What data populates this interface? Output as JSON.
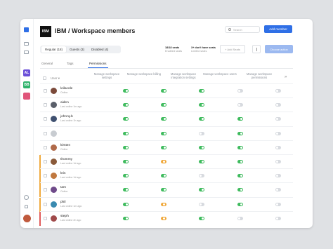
{
  "rail": {
    "avatars": [
      {
        "label": "AL",
        "color": "#6a4fd8"
      },
      {
        "label": "BB",
        "color": "#2fb36b"
      },
      {
        "label": "",
        "color": "#e0557a"
      }
    ]
  },
  "header": {
    "logo_text": "IBM",
    "title": "IBM / Workspace members",
    "search_placeholder": "Search",
    "add_member_label": "Add member"
  },
  "toolbar": {
    "segments": [
      "Regular (18)",
      "Guests (3)",
      "Disabled (4)"
    ],
    "active_segment": 0,
    "stats": [
      {
        "value": "18/18 seats",
        "label": "Enabled seats"
      },
      {
        "value": "3+ don't have seats",
        "label": "Limited seats"
      }
    ],
    "add_seats_label": "+ Add Seats",
    "choose_action_label": "Choose action"
  },
  "tabs": [
    "General",
    "Tags",
    "Permissions"
  ],
  "active_tab": 2,
  "table": {
    "user_header": "User",
    "columns": [
      "Manage workspace settings",
      "Manage workspace billing",
      "Manage workspace integration settings",
      "Manage workspace users",
      "Manage workspace permissions"
    ],
    "rows": [
      {
        "name": "leilacole",
        "sub": "Online",
        "flag": "",
        "avatar": "#7b4a3a",
        "toggles": [
          "on",
          "on",
          "on",
          "off",
          "off"
        ]
      },
      {
        "name": "aiden",
        "sub": "Last online 1m ago",
        "flag": "",
        "avatar": "#5a5f6a",
        "toggles": [
          "on",
          "on",
          "on",
          "off",
          "off"
        ]
      },
      {
        "name": "johnny.b",
        "sub": "Last online 1h ago",
        "flag": "",
        "avatar": "#3f5070",
        "toggles": [
          "on",
          "on",
          "on",
          "on",
          "off"
        ]
      },
      {
        "name": "",
        "sub": "",
        "flag": "",
        "avatar": "#c8ccd1",
        "toggles": [
          "on",
          "on",
          "off",
          "on",
          "off"
        ]
      },
      {
        "name": "kirsten",
        "sub": "Online",
        "flag": "",
        "avatar": "#b06a4a",
        "toggles": [
          "on",
          "on",
          "on",
          "on",
          "off"
        ]
      },
      {
        "name": "thommy",
        "sub": "Last online 1d ago",
        "flag": "#f0a93c",
        "avatar": "#8a5a3a",
        "toggles": [
          "on",
          "partial",
          "on",
          "on",
          "off"
        ]
      },
      {
        "name": "kris",
        "sub": "Last online 1d ago",
        "flag": "#f0a93c",
        "avatar": "#c0783f",
        "toggles": [
          "on",
          "on",
          "off",
          "on",
          "off"
        ]
      },
      {
        "name": "tam",
        "sub": "Online",
        "flag": "#f0a93c",
        "avatar": "#6f4a8a",
        "toggles": [
          "on",
          "on",
          "on",
          "on",
          "off"
        ]
      },
      {
        "name": "phil",
        "sub": "Last online 1m ago",
        "flag": "#f0a93c",
        "avatar": "#3a8ab0",
        "toggles": [
          "on",
          "partial",
          "off",
          "on",
          "off"
        ]
      },
      {
        "name": "steph",
        "sub": "Last online 2h ago",
        "flag": "#e05a5a",
        "avatar": "#a04a4a",
        "toggles": [
          "on",
          "partial",
          "on",
          "off",
          "off"
        ]
      }
    ]
  }
}
